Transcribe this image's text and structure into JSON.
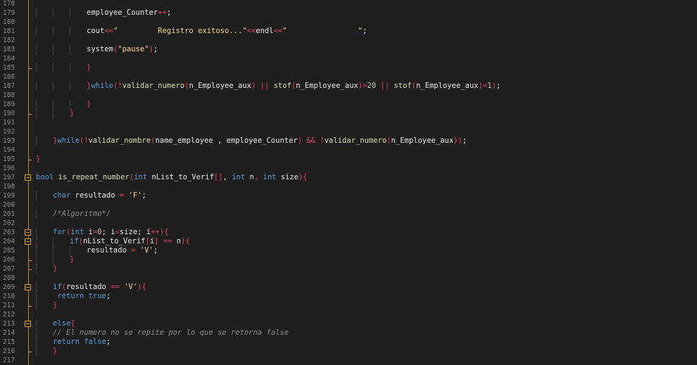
{
  "editor": {
    "language": "C++",
    "lines": [
      {
        "n": "178",
        "indent": 0,
        "tokens": []
      },
      {
        "n": "179",
        "indent": 3,
        "tokens": [
          [
            "id",
            "employee_Counter"
          ],
          [
            "op",
            "++"
          ],
          [
            "id",
            ";"
          ]
        ]
      },
      {
        "n": "180",
        "indent": 0,
        "tokens": []
      },
      {
        "n": "181",
        "indent": 3,
        "tokens": [
          [
            "id",
            "cout"
          ],
          [
            "op",
            "<<"
          ],
          [
            "str",
            "\"         Registro exitoso...\""
          ],
          [
            "op",
            "<<"
          ],
          [
            "id",
            "endl"
          ],
          [
            "op",
            "<<"
          ],
          [
            "str",
            "\"                \""
          ],
          [
            "id",
            ";"
          ]
        ]
      },
      {
        "n": "182",
        "indent": 0,
        "tokens": []
      },
      {
        "n": "183",
        "indent": 3,
        "tokens": [
          [
            "id",
            "system"
          ],
          [
            "br",
            "("
          ],
          [
            "str",
            "\"pause\""
          ],
          [
            "br",
            ")"
          ],
          [
            "id",
            ";"
          ]
        ]
      },
      {
        "n": "184",
        "indent": 0,
        "tokens": []
      },
      {
        "n": "185",
        "indent": 3,
        "tokens": [
          [
            "br",
            "}"
          ]
        ]
      },
      {
        "n": "186",
        "indent": 0,
        "tokens": []
      },
      {
        "n": "187",
        "indent": 3,
        "tokens": [
          [
            "br",
            "}"
          ],
          [
            "kw",
            "while"
          ],
          [
            "br",
            "("
          ],
          [
            "op",
            "!"
          ],
          [
            "fn",
            "validar_numero"
          ],
          [
            "br",
            "("
          ],
          [
            "id",
            "n_Employee_aux"
          ],
          [
            "br",
            ")"
          ],
          [
            "id",
            " "
          ],
          [
            "op",
            "||"
          ],
          [
            "id",
            " "
          ],
          [
            "fn",
            "stof"
          ],
          [
            "br",
            "("
          ],
          [
            "id",
            "n_Employee_aux"
          ],
          [
            "br",
            ")"
          ],
          [
            "op",
            ">"
          ],
          [
            "num",
            "20"
          ],
          [
            "id",
            " "
          ],
          [
            "op",
            "||"
          ],
          [
            "id",
            " "
          ],
          [
            "fn",
            "stof"
          ],
          [
            "br",
            "("
          ],
          [
            "id",
            "n_Employee_aux"
          ],
          [
            "br",
            ")"
          ],
          [
            "op",
            "<"
          ],
          [
            "num",
            "1"
          ],
          [
            "br",
            ")"
          ],
          [
            "id",
            ";"
          ]
        ]
      },
      {
        "n": "188",
        "indent": 0,
        "tokens": []
      },
      {
        "n": "189",
        "indent": 3,
        "tokens": [
          [
            "br",
            "}"
          ]
        ]
      },
      {
        "n": "190",
        "indent": 2,
        "tokens": [
          [
            "br",
            "}"
          ]
        ]
      },
      {
        "n": "191",
        "indent": 0,
        "tokens": []
      },
      {
        "n": "192",
        "indent": 0,
        "tokens": []
      },
      {
        "n": "193",
        "indent": 1,
        "tokens": [
          [
            "br",
            "}"
          ],
          [
            "kw",
            "while"
          ],
          [
            "br",
            "("
          ],
          [
            "op",
            "!"
          ],
          [
            "fn",
            "validar_nombre"
          ],
          [
            "br",
            "("
          ],
          [
            "id",
            "name_employee , employee_Counter"
          ],
          [
            "br",
            ")"
          ],
          [
            "id",
            " "
          ],
          [
            "op",
            "&&"
          ],
          [
            "id",
            " "
          ],
          [
            "op",
            "!"
          ],
          [
            "fn",
            "validar_numero"
          ],
          [
            "br",
            "("
          ],
          [
            "id",
            "n_Employee_aux"
          ],
          [
            "br",
            "))"
          ],
          [
            "id",
            ";"
          ]
        ]
      },
      {
        "n": "194",
        "indent": 0,
        "tokens": []
      },
      {
        "n": "195",
        "indent": 0,
        "tokens": [
          [
            "br",
            "}"
          ]
        ]
      },
      {
        "n": "196",
        "indent": 0,
        "tokens": []
      },
      {
        "n": "197",
        "indent": 0,
        "tokens": [
          [
            "kw",
            "bool"
          ],
          [
            "id",
            " "
          ],
          [
            "fn",
            "is_repeat_number"
          ],
          [
            "br",
            "("
          ],
          [
            "kw",
            "int"
          ],
          [
            "id",
            " nList_to_Verif"
          ],
          [
            "br",
            "[]"
          ],
          [
            "id",
            ", "
          ],
          [
            "kw",
            "int"
          ],
          [
            "id",
            " n"
          ],
          [
            "op",
            ","
          ],
          [
            "id",
            " "
          ],
          [
            "kw",
            "int"
          ],
          [
            "id",
            " size"
          ],
          [
            "br",
            ")"
          ],
          [
            "br",
            "{"
          ]
        ]
      },
      {
        "n": "198",
        "indent": 0,
        "tokens": []
      },
      {
        "n": "199",
        "indent": 1,
        "tokens": [
          [
            "kw",
            "char"
          ],
          [
            "id",
            " resultado "
          ],
          [
            "op",
            "="
          ],
          [
            "id",
            " "
          ],
          [
            "str",
            "'F'"
          ],
          [
            "id",
            ";"
          ]
        ]
      },
      {
        "n": "200",
        "indent": 0,
        "tokens": []
      },
      {
        "n": "201",
        "indent": 1,
        "tokens": [
          [
            "cm",
            "/*Algoritmo*/"
          ]
        ]
      },
      {
        "n": "202",
        "indent": 0,
        "tokens": []
      },
      {
        "n": "203",
        "indent": 1,
        "tokens": [
          [
            "kw",
            "for"
          ],
          [
            "br",
            "("
          ],
          [
            "kw",
            "int"
          ],
          [
            "id",
            " i"
          ],
          [
            "op",
            "="
          ],
          [
            "num",
            "0"
          ],
          [
            "id",
            "; i"
          ],
          [
            "op",
            "<"
          ],
          [
            "id",
            "size; i"
          ],
          [
            "op",
            "++"
          ],
          [
            "br",
            ")"
          ],
          [
            "br",
            "{"
          ]
        ]
      },
      {
        "n": "204",
        "indent": 2,
        "tokens": [
          [
            "kw",
            "if"
          ],
          [
            "br",
            "("
          ],
          [
            "id",
            "nList_to_Verif"
          ],
          [
            "br",
            "["
          ],
          [
            "id",
            "i"
          ],
          [
            "br",
            "]"
          ],
          [
            "id",
            " "
          ],
          [
            "op",
            "=="
          ],
          [
            "id",
            " n"
          ],
          [
            "br",
            ")"
          ],
          [
            "br",
            "{"
          ]
        ]
      },
      {
        "n": "205",
        "indent": 3,
        "tokens": [
          [
            "id",
            "resultado "
          ],
          [
            "op",
            "="
          ],
          [
            "id",
            " "
          ],
          [
            "str",
            "'V'"
          ],
          [
            "id",
            ";"
          ]
        ]
      },
      {
        "n": "206",
        "indent": 2,
        "tokens": [
          [
            "br",
            "}"
          ]
        ]
      },
      {
        "n": "207",
        "indent": 1,
        "tokens": [
          [
            "br",
            "}"
          ]
        ]
      },
      {
        "n": "208",
        "indent": 0,
        "tokens": []
      },
      {
        "n": "209",
        "indent": 1,
        "tokens": [
          [
            "kw",
            "if"
          ],
          [
            "br",
            "("
          ],
          [
            "id",
            "resultado "
          ],
          [
            "op",
            "=="
          ],
          [
            "id",
            " "
          ],
          [
            "str",
            "'V'"
          ],
          [
            "br",
            ")"
          ],
          [
            "br",
            "{"
          ]
        ]
      },
      {
        "n": "210",
        "indent": 1,
        "tokens": [
          [
            "id",
            " "
          ],
          [
            "kw",
            "return"
          ],
          [
            "id",
            " "
          ],
          [
            "kw",
            "true"
          ],
          [
            "id",
            ";"
          ]
        ]
      },
      {
        "n": "211",
        "indent": 1,
        "tokens": [
          [
            "br",
            "}"
          ]
        ]
      },
      {
        "n": "212",
        "indent": 0,
        "tokens": []
      },
      {
        "n": "213",
        "indent": 1,
        "tokens": [
          [
            "kw",
            "else"
          ],
          [
            "br",
            "{"
          ]
        ]
      },
      {
        "n": "214",
        "indent": 1,
        "tokens": [
          [
            "cm",
            "// El numero no se repite por lo que se retorna false"
          ]
        ]
      },
      {
        "n": "215",
        "indent": 1,
        "tokens": [
          [
            "kw",
            "return"
          ],
          [
            "id",
            " "
          ],
          [
            "kw",
            "false"
          ],
          [
            "id",
            ";"
          ]
        ]
      },
      {
        "n": "216",
        "indent": 1,
        "tokens": [
          [
            "br",
            "}"
          ]
        ]
      },
      {
        "n": "217",
        "indent": 0,
        "tokens": []
      }
    ]
  },
  "colors": {
    "background": "#1e1e1e",
    "keyword": "#569cd6",
    "function": "#dcdcaa",
    "string": "#ffd580",
    "operator": "#e0405a",
    "fold_marker": "#e0982c"
  }
}
